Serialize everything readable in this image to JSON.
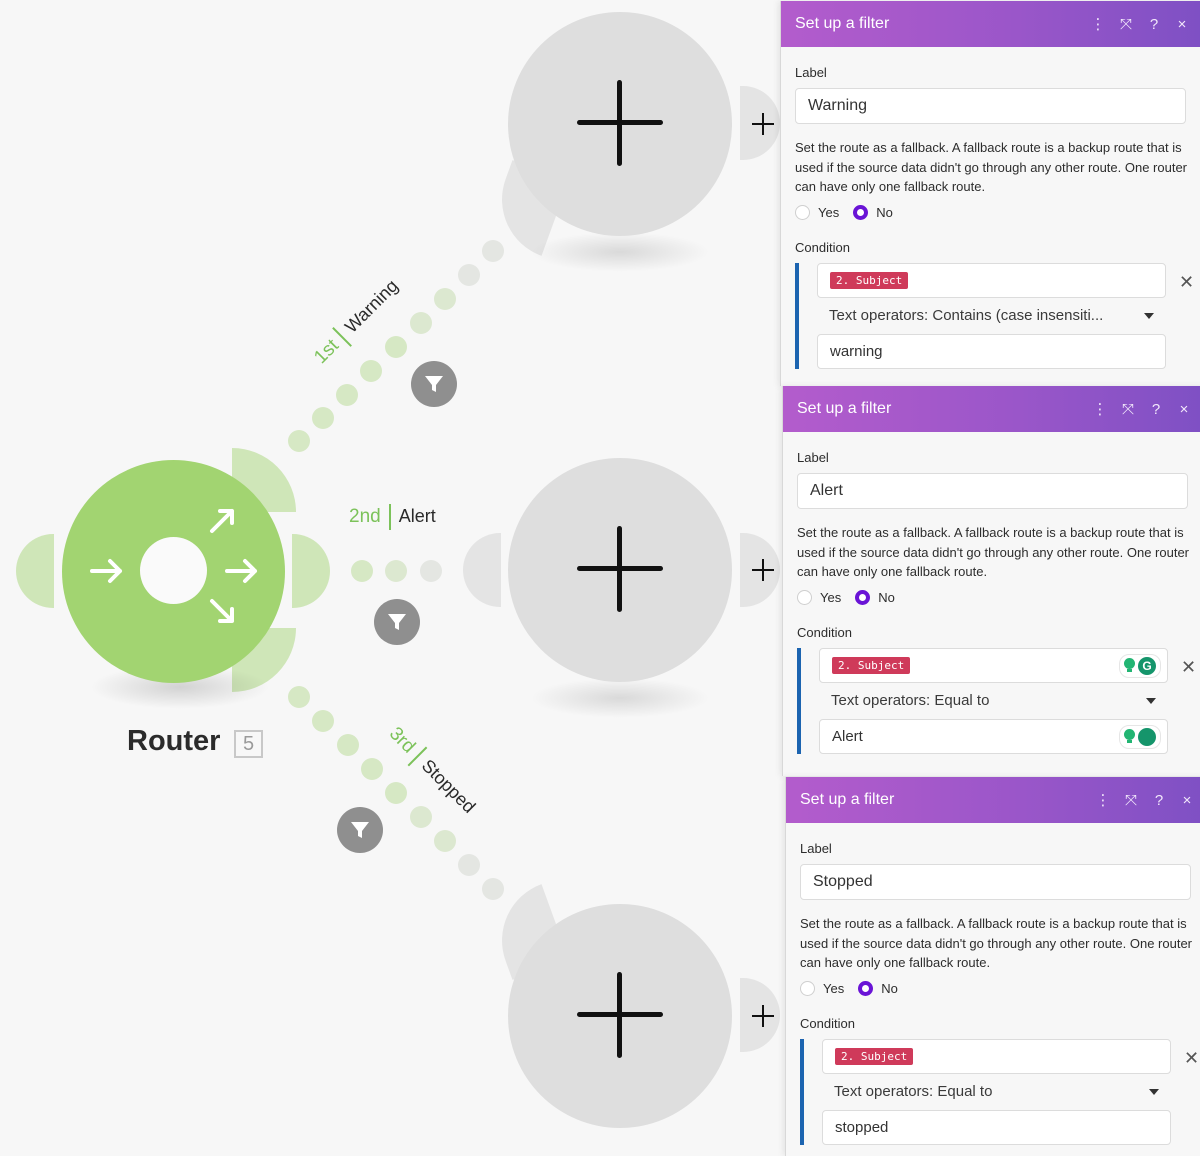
{
  "router": {
    "title": "Router",
    "module_id": "5"
  },
  "routes": [
    {
      "order": "1st",
      "name": "Warning"
    },
    {
      "order": "2nd",
      "name": "Alert"
    },
    {
      "order": "3rd",
      "name": "Stopped"
    }
  ],
  "panels": [
    {
      "title": "Set up a filter",
      "label_caption": "Label",
      "label_value": "Warning",
      "fallback_help": "Set the route as a fallback. A fallback route is a backup route that is used if the source data didn't go through any other route. One router can have only one fallback route.",
      "fallback_yes": "Yes",
      "fallback_no": "No",
      "fallback_selected": "No",
      "condition_caption": "Condition",
      "condition_field_tag": "2. Subject",
      "operator": "Text operators: Contains (case insensiti...",
      "value": "warning"
    },
    {
      "title": "Set up a filter",
      "label_caption": "Label",
      "label_value": "Alert",
      "fallback_help": "Set the route as a fallback. A fallback route is a backup route that is used if the source data didn't go through any other route. One router can have only one fallback route.",
      "fallback_yes": "Yes",
      "fallback_no": "No",
      "fallback_selected": "No",
      "condition_caption": "Condition",
      "condition_field_tag": "2. Subject",
      "operator": "Text operators: Equal to",
      "value": "Alert"
    },
    {
      "title": "Set up a filter",
      "label_caption": "Label",
      "label_value": "Stopped",
      "fallback_help": "Set the route as a fallback. A fallback route is a backup route that is used if the source data didn't go through any other route. One router can have only one fallback route.",
      "fallback_yes": "Yes",
      "fallback_no": "No",
      "fallback_selected": "No",
      "condition_caption": "Condition",
      "condition_field_tag": "2. Subject",
      "operator": "Text operators: Equal to",
      "value": "stopped"
    }
  ],
  "header_icons": [
    "more-vertical-icon",
    "expand-icon",
    "help-icon",
    "close-icon"
  ],
  "header_glyphs": {
    "more": "⋮",
    "expand": "⤧",
    "help": "?",
    "close": "×"
  },
  "remove_glyph": "✕",
  "grammarly_glyph": "G",
  "colors": {
    "router_green": "#a2d471",
    "route_order_green": "#7cc25a",
    "panel_header_start": "#b35ccc",
    "panel_header_end": "#7d50c4",
    "radio_selected": "#6a14d6",
    "condition_bar": "#1c64b0",
    "field_tag": "#cf3a5a",
    "filter_button": "#8f8f8f"
  }
}
